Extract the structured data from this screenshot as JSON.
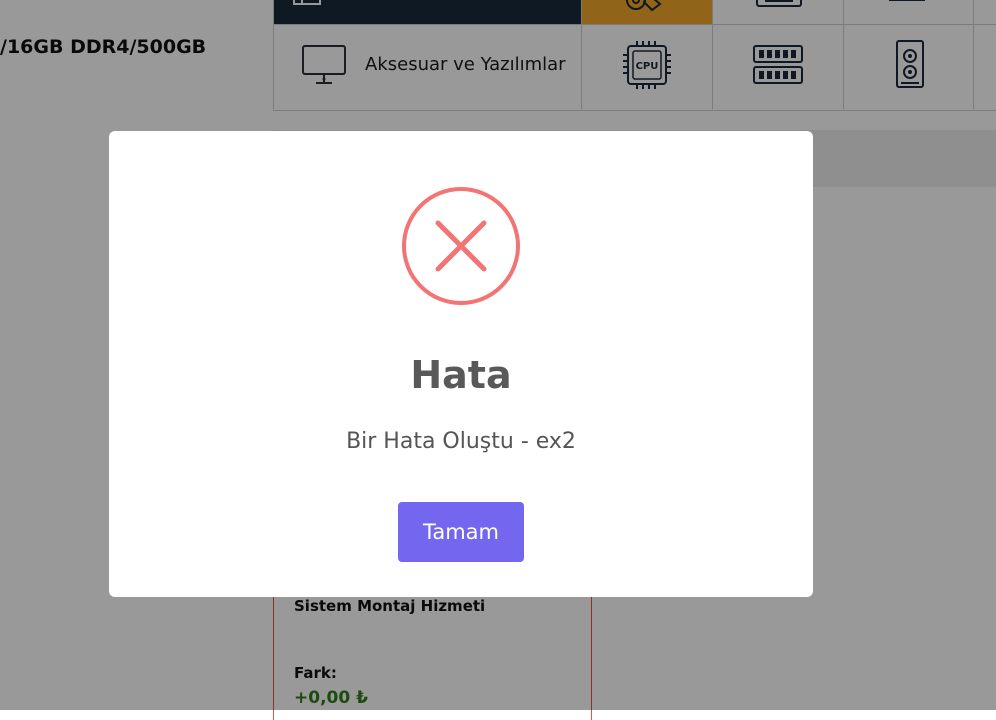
{
  "product": {
    "title": "/16GB DDR4/500GB"
  },
  "category_menu": {
    "label": "Aksesuar ve Yazılımlar",
    "icons": [
      "monitor-icon",
      "cpu-icon",
      "ram-icon",
      "case-icon"
    ],
    "cpu_icon_text": "CPU",
    "active_color": "#f2a82a",
    "dark_color": "#1a2b3c"
  },
  "lower_card": {
    "service_title": "Sistem Montaj Hizmeti",
    "diff_label": "Fark:",
    "diff_value": "+0,00 ₺",
    "diff_color": "#2e7d16",
    "border_color": "#e6553a"
  },
  "modal": {
    "icon": "error-x-icon",
    "icon_color": "#f27474",
    "title": "Hata",
    "message": "Bir Hata Oluştu - ex2",
    "confirm_label": "Tamam",
    "confirm_color": "#7367f0"
  }
}
